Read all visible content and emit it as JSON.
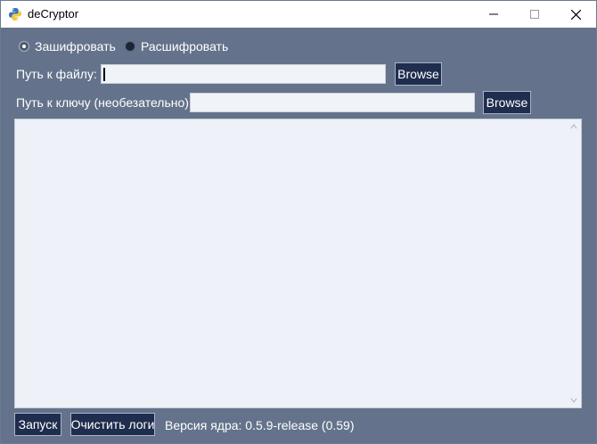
{
  "window": {
    "title": "deCryptor"
  },
  "mode": {
    "options": [
      {
        "label": "Зашифровать",
        "selected": true
      },
      {
        "label": "Расшифровать",
        "selected": false
      }
    ]
  },
  "file": {
    "label": "Путь к файлу:",
    "value": "",
    "browse_label": "Browse"
  },
  "key": {
    "label": "Путь к ключу (необезательно):",
    "value": "",
    "browse_label": "Browse"
  },
  "log": {
    "text": ""
  },
  "footer": {
    "run_label": "Запуск",
    "clear_label": "Очистить логи",
    "version_text": "Версия ядра: 0.5.9-release (0.59)"
  },
  "colors": {
    "background": "#64738b",
    "button": "#1f2d4e",
    "input": "#f0f3f8"
  },
  "icons": [
    "python-icon",
    "minimize-icon",
    "maximize-icon",
    "close-icon",
    "scroll-up-icon",
    "scroll-down-icon"
  ]
}
